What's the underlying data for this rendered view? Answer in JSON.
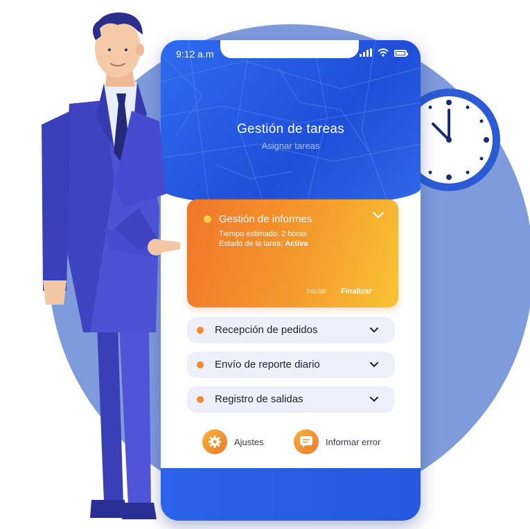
{
  "status_bar": {
    "time": "9:12 a.m"
  },
  "header": {
    "title": "Gestión de tareas",
    "subtitle": "Asignar tareas"
  },
  "active_task": {
    "title": "Gestión de informes",
    "time_estimate": "Tiempo estimado: 2 horas",
    "status_prefix": "Estado de la tarea: ",
    "status_value": "Activa",
    "start_label": "Iniciar",
    "finish_label": "Finalizar"
  },
  "tasks": [
    {
      "label": "Recepción de pedidos"
    },
    {
      "label": "Envío de reporte diario"
    },
    {
      "label": "Registro de salidas"
    }
  ],
  "actions": {
    "settings_label": "Ajustes",
    "report_label": "Informar error"
  },
  "icons": {
    "chevron": "chevron-down-icon",
    "settings": "gear-icon",
    "report": "message-icon",
    "signal": "signal-icon",
    "wifi": "wifi-icon",
    "battery": "battery-icon"
  },
  "colors": {
    "primary": "#2459e0",
    "accent_start": "#f0762a",
    "accent_end": "#f8c333",
    "background_circle": "#7e9bdc"
  }
}
